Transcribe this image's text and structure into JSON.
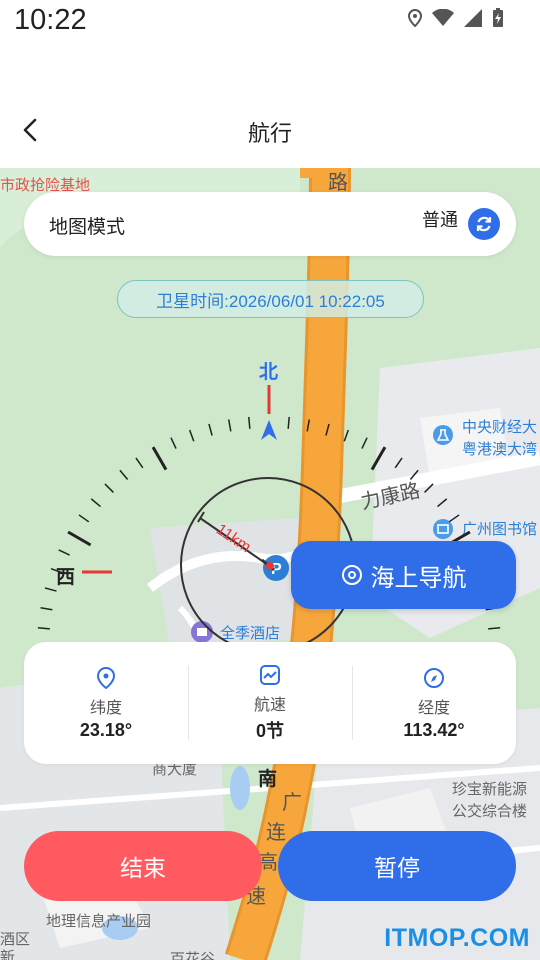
{
  "status_bar": {
    "time": "10:22",
    "icons": [
      "location-icon",
      "wifi-icon",
      "signal-icon",
      "battery-charging-icon"
    ]
  },
  "header": {
    "title": "航行",
    "back_icon": "chevron-left-icon"
  },
  "map_mode": {
    "title": "地图模式",
    "value": "普通",
    "switch_icon": "refresh-icon"
  },
  "satellite_time": "卫星时间:2026/06/01 10:22:05",
  "compass": {
    "north": "北",
    "west": "西",
    "south": "南",
    "scale_label": "11km"
  },
  "sea_nav": {
    "label": "海上导航",
    "icon": "target-icon"
  },
  "stats": [
    {
      "icon": "location-pin-icon",
      "label": "纬度",
      "value": "23.18°"
    },
    {
      "icon": "speed-chart-icon",
      "label": "航速",
      "value": "0节"
    },
    {
      "icon": "compass-icon",
      "label": "经度",
      "value": "113.42°"
    }
  ],
  "buttons": {
    "end": "结束",
    "pause": "暂停"
  },
  "map_labels": {
    "top_left_1": "市政抢险基地",
    "road_top": "路",
    "road_likang": "力康路",
    "poi_1a": "中央财经大",
    "poi_1b": "粤港澳大湾",
    "poi_2": "广州图书馆",
    "poi_3": "全季酒店",
    "poi_4": "珍宝新能源",
    "poi_5": "公交综合楼",
    "poi_6": "地理信息产业园",
    "poi_7": "百花谷",
    "poi_8": "酒区",
    "road_bottom_1": "广",
    "road_bottom_2": "连",
    "road_bottom_3": "高",
    "road_bottom_4": "速",
    "poi_9": "商大厦",
    "poi_10": "新"
  },
  "watermark": "ITMOP.COM",
  "colors": {
    "primary": "#2f6ee8",
    "danger": "#ff5a60",
    "compass_red": "#e53935",
    "highway": "#f7a63b"
  }
}
